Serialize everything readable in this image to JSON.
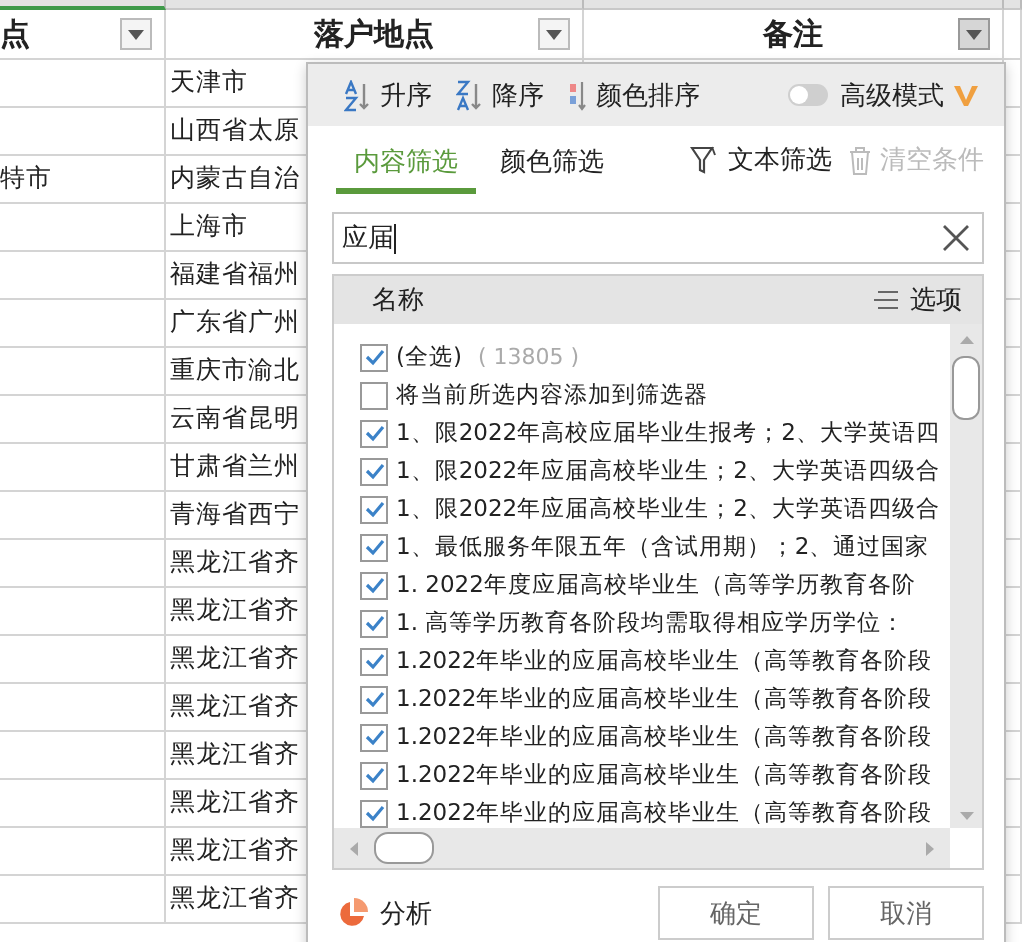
{
  "sheet": {
    "columns": [
      {
        "header": "点"
      },
      {
        "header": "落户地点"
      },
      {
        "header": "备注",
        "active": true
      }
    ],
    "rows": [
      [
        "",
        "天津市"
      ],
      [
        "",
        "山西省太原"
      ],
      [
        "特市",
        "内蒙古自治"
      ],
      [
        "",
        "上海市"
      ],
      [
        "",
        "福建省福州"
      ],
      [
        "",
        "广东省广州"
      ],
      [
        "",
        "重庆市渝北"
      ],
      [
        "",
        "云南省昆明"
      ],
      [
        "",
        "甘肃省兰州"
      ],
      [
        "",
        "青海省西宁"
      ],
      [
        "",
        "黑龙江省齐"
      ],
      [
        "",
        "黑龙江省齐"
      ],
      [
        "",
        "黑龙江省齐"
      ],
      [
        "",
        "黑龙江省齐"
      ],
      [
        "",
        "黑龙江省齐"
      ],
      [
        "",
        "黑龙江省齐"
      ],
      [
        "",
        "黑龙江省齐"
      ],
      [
        "",
        "黑龙江省齐"
      ]
    ]
  },
  "filter_popup": {
    "sort_buttons": [
      {
        "kind": "asc",
        "label": "升序"
      },
      {
        "kind": "desc",
        "label": "降序"
      },
      {
        "kind": "color",
        "label": "颜色排序"
      }
    ],
    "advanced_mode": {
      "label": "高级模式",
      "on": false
    },
    "tabs": [
      {
        "label": "内容筛选",
        "selected": true
      },
      {
        "label": "颜色筛选",
        "selected": false
      }
    ],
    "text_filter": "文本筛选",
    "clear_conditions": {
      "label": "清空条件",
      "disabled": true
    },
    "search": {
      "value": "应届"
    },
    "list": {
      "header": "名称",
      "options": "选项",
      "items": [
        {
          "label": "(全选)",
          "count": "( 13805 )",
          "checked": true
        },
        {
          "label": "将当前所选内容添加到筛选器",
          "checked": false
        },
        {
          "label": "1、限2022年高校应届毕业生报考；2、大学英语四",
          "checked": true
        },
        {
          "label": "1、限2022年应届高校毕业生；2、大学英语四级合",
          "checked": true
        },
        {
          "label": "1、限2022年应届高校毕业生；2、大学英语四级合",
          "checked": true
        },
        {
          "label": "1、最低服务年限五年（含试用期）；2、通过国家",
          "checked": true
        },
        {
          "label": "1. 2022年度应届高校毕业生（高等学历教育各阶",
          "checked": true
        },
        {
          "label": "1. 高等学历教育各阶段均需取得相应学历学位：",
          "checked": true
        },
        {
          "label": "1.2022年毕业的应届高校毕业生（高等教育各阶段",
          "checked": true
        },
        {
          "label": "1.2022年毕业的应届高校毕业生（高等教育各阶段",
          "checked": true
        },
        {
          "label": "1.2022年毕业的应届高校毕业生（高等教育各阶段",
          "checked": true
        },
        {
          "label": "1.2022年毕业的应届高校毕业生（高等教育各阶段",
          "checked": true
        },
        {
          "label": "1.2022年毕业的应届高校毕业生（高等教育各阶段",
          "checked": true
        }
      ]
    },
    "analyze": "分析",
    "buttons": [
      {
        "label": "确定"
      },
      {
        "label": "取消"
      }
    ]
  }
}
